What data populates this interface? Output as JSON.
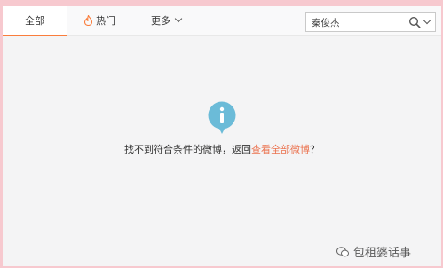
{
  "tabs": {
    "all": "全部",
    "hot": "热门",
    "more": "更多"
  },
  "search": {
    "value": "秦俊杰"
  },
  "empty_state": {
    "text": "找不到符合条件的微博，返回",
    "link": "查看全部微博",
    "suffix": "？"
  },
  "watermark": {
    "text": "包租婆话事"
  },
  "colors": {
    "background": "#f7c9cf",
    "accent": "#fa7d3c",
    "link": "#eb7350",
    "info_icon": "#6bbbd8"
  },
  "icons": {
    "hot": "flame-icon",
    "search": "search-icon",
    "info": "info-icon",
    "watermark": "wechat-icon"
  }
}
